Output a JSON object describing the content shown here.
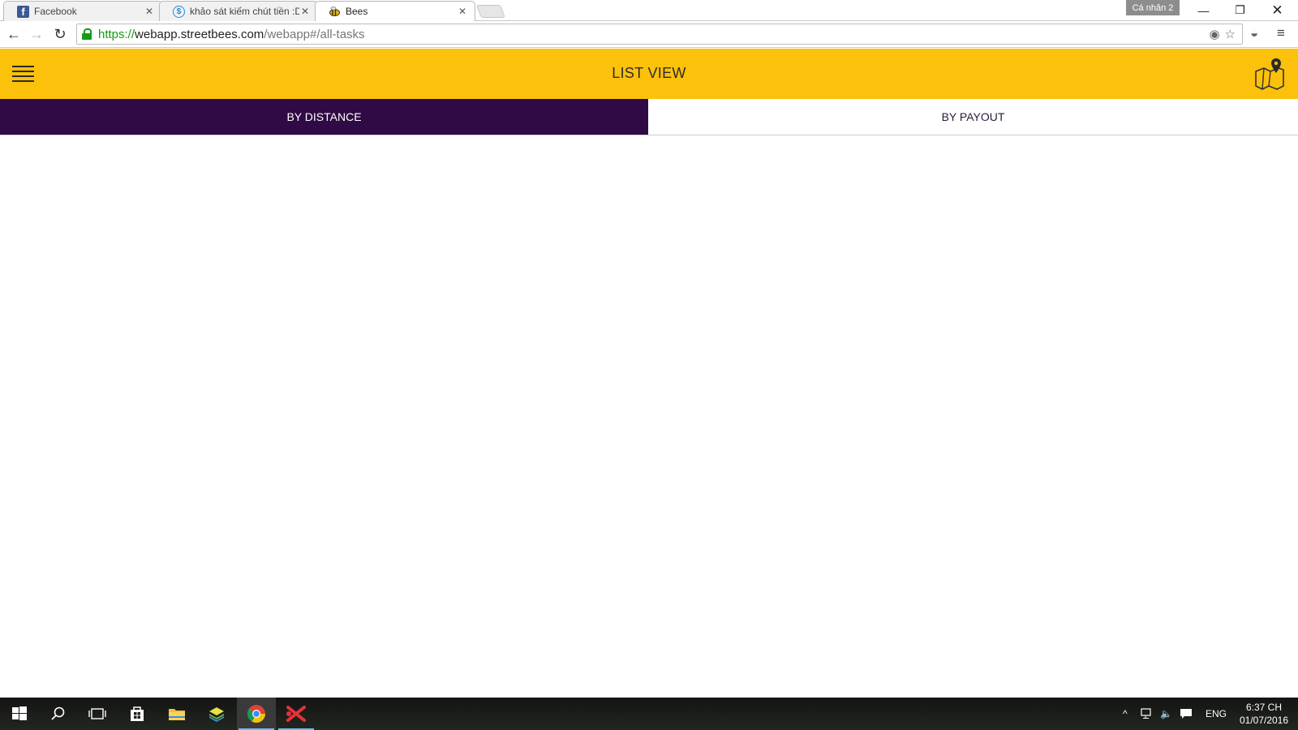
{
  "browser": {
    "tabs": [
      {
        "title": "Facebook",
        "icon": "facebook-icon"
      },
      {
        "title": "khảo sát kiếm chút tiền :D",
        "icon": "survey-site-icon"
      },
      {
        "title": "Bees",
        "icon": "bee-icon"
      }
    ],
    "profile_label": "Cá nhân 2",
    "url": {
      "scheme": "https://",
      "host": "webapp.streetbees.com",
      "path": "/webapp#/all-tasks"
    }
  },
  "app": {
    "header_title": "LIST VIEW",
    "tabs": [
      {
        "label": "BY DISTANCE",
        "active": true
      },
      {
        "label": "BY PAYOUT",
        "active": false
      }
    ],
    "colors": {
      "header_bg": "#fcc10a",
      "active_tab_bg": "#300a44"
    }
  },
  "taskbar": {
    "apps": [
      "start-icon",
      "search-icon",
      "task-view-icon",
      "store-icon",
      "file-explorer-icon",
      "bluestacks-icon",
      "chrome-icon",
      "xmind-icon"
    ],
    "language": "ENG",
    "time": "6:37 CH",
    "date": "01/07/2016"
  }
}
